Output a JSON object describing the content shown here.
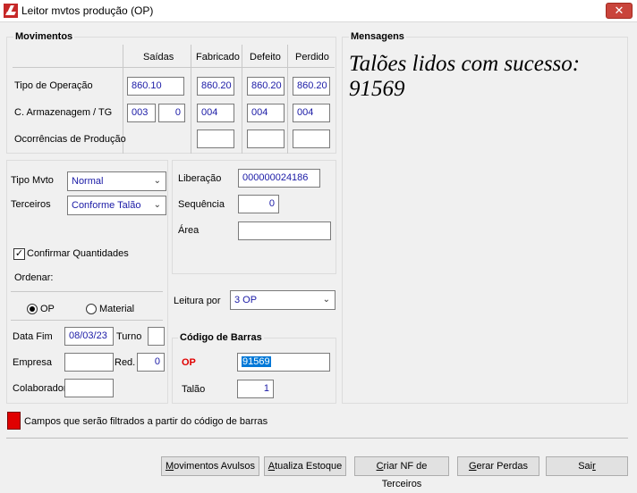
{
  "window": {
    "title": "Leitor mvtos produção (OP)",
    "close_glyph": "✕"
  },
  "movimentos": {
    "title": "Movimentos",
    "columns": [
      "Saídas",
      "Fabricado",
      "Defeito",
      "Perdido"
    ],
    "rows": {
      "tipo_operacao": {
        "label": "Tipo de Operação",
        "saidas": "860.10",
        "fabricado": "860.20",
        "defeito": "860.20",
        "perdido": "860.20"
      },
      "armazenagem": {
        "label": "C. Armazenagem / TG",
        "saidas_a": "003",
        "saidas_b": "0",
        "fabricado": "004",
        "defeito": "004",
        "perdido": "004"
      },
      "ocorrencias": {
        "label": "Ocorrências de Produção"
      }
    }
  },
  "mensagens": {
    "title": "Mensagens",
    "text_line1": "Talões lidos com sucesso:",
    "text_line2": "91569"
  },
  "left": {
    "tipo_mvto_label": "Tipo Mvto",
    "tipo_mvto_value": "Normal",
    "terceiros_label": "Terceiros",
    "terceiros_value": "Conforme Talão",
    "confirmar_label": "Confirmar Quantidades",
    "confirmar_checked": true,
    "ordenar_label": "Ordenar:",
    "radio_op": "OP",
    "radio_material": "Material",
    "radio_selected": "OP",
    "data_fim_label": "Data Fim",
    "data_fim_value": "08/03/23",
    "turno_label": "Turno",
    "turno_value": "",
    "empresa_label": "Empresa",
    "empresa_value": "",
    "red_label": "Red.",
    "red_value": "0",
    "colaborador_label": "Colaborador",
    "colaborador_value": ""
  },
  "middle": {
    "liberacao_label": "Liberação",
    "liberacao_value": "000000024186",
    "sequencia_label": "Sequência",
    "sequencia_value": "0",
    "area_label": "Área",
    "area_value": "",
    "leitura_label": "Leitura por",
    "leitura_value": "3 OP"
  },
  "barcode": {
    "title": "Código de Barras",
    "op_label": "OP",
    "op_value": "91569",
    "talao_label": "Talão",
    "talao_value": "1",
    "op_label_color": "#e00000"
  },
  "legend": {
    "text": "Campos que serão filtrados a partir do código de barras",
    "color": "#e00000"
  },
  "buttons": {
    "avulsos": {
      "pre": "",
      "u": "M",
      "post": "ovimentos Avulsos"
    },
    "estoque": {
      "pre": "",
      "u": "A",
      "post": "tualiza Estoque"
    },
    "nf": {
      "pre": "",
      "u": "C",
      "post": "riar NF de Terceiros"
    },
    "perdas": {
      "pre": "",
      "u": "G",
      "post": "erar Perdas"
    },
    "sair": {
      "pre": "Sai",
      "u": "r",
      "post": ""
    }
  }
}
